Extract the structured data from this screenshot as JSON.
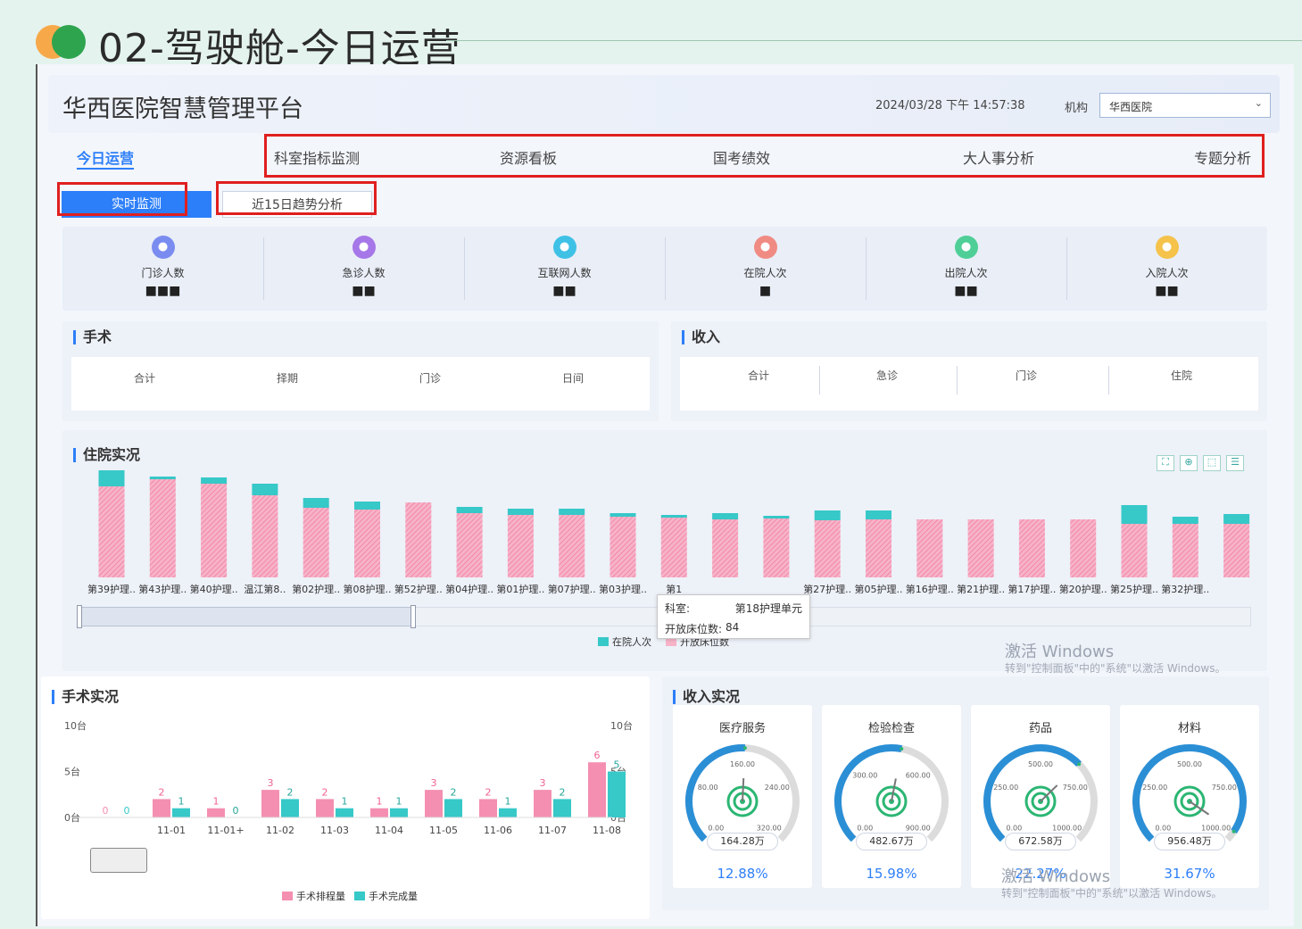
{
  "slide": {
    "title": "02-驾驶舱-今日运营"
  },
  "header": {
    "platform_title": "华西医院智慧管理平台",
    "datetime": "2024/03/28 下午 14:57:38",
    "org_label": "机构",
    "org_value": "华西医院"
  },
  "nav": {
    "tabs": [
      "今日运营",
      "科室指标监测",
      "资源看板",
      "国考绩效",
      "大人事分析",
      "专题分析"
    ]
  },
  "subtabs": [
    "实时监测",
    "近15日趋势分析"
  ],
  "metrics": [
    {
      "label": "门诊人数",
      "value": "■■■",
      "color": "#7b8cf0",
      "icon": "people-icon"
    },
    {
      "label": "急诊人数",
      "value": "■■",
      "color": "#a677e8",
      "icon": "ambulance-icon"
    },
    {
      "label": "互联网人数",
      "value": "■■",
      "color": "#3fc1e6",
      "icon": "globe-icon"
    },
    {
      "label": "在院人次",
      "value": "■",
      "color": "#f08b83",
      "icon": "bed-icon"
    },
    {
      "label": "出院人次",
      "value": "■■",
      "color": "#4fcf97",
      "icon": "bed-out-icon"
    },
    {
      "label": "入院人次",
      "value": "■■",
      "color": "#f5c24a",
      "icon": "crown-icon"
    }
  ],
  "surgery": {
    "title": "手术",
    "items": [
      {
        "label": "合计",
        "value": ""
      },
      {
        "label": "择期",
        "value": ""
      },
      {
        "label": "门诊",
        "value": ""
      },
      {
        "label": "日间",
        "value": ""
      }
    ]
  },
  "income": {
    "title": "收入",
    "items": [
      {
        "label": "合计",
        "value": ""
      },
      {
        "label": "急诊",
        "value": ""
      },
      {
        "label": "门诊",
        "value": ""
      },
      {
        "label": "住院",
        "value": ""
      }
    ]
  },
  "inpatient": {
    "title": "住院实况",
    "legend": [
      "在院人次",
      "开放床位数"
    ],
    "tooltip": {
      "dept_label": "科室:",
      "dept_value": "第18护理单元",
      "beds_label": "开放床位数:",
      "beds_value": "84"
    },
    "toolbar_icons": [
      "fullscreen-icon",
      "zoom-icon",
      "select-icon",
      "list-icon"
    ]
  },
  "chart_data": [
    {
      "type": "bar",
      "title": "住院实况",
      "categories": [
        "第39护理..",
        "第43护理..",
        "第40护理..",
        "温江第8..",
        "第02护理..",
        "第08护理..",
        "第52护理..",
        "第04护理..",
        "第01护理..",
        "第07护理..",
        "第03护理..",
        "第1",
        "",
        "",
        "第27护理..",
        "第05护理..",
        "第16护理..",
        "第21护理..",
        "第17护理..",
        "第20护理..",
        "第25护理..",
        "第32护理..",
        "第18护理单元"
      ],
      "series": [
        {
          "name": "开放床位数",
          "values": [
            102,
            110,
            105,
            92,
            78,
            76,
            84,
            72,
            70,
            70,
            68,
            67,
            65,
            66,
            64,
            65,
            65,
            65,
            65,
            65,
            60,
            60,
            60
          ]
        },
        {
          "name": "在院人次",
          "values": [
            18,
            3,
            7,
            13,
            11,
            9,
            0,
            7,
            7,
            7,
            4,
            3,
            7,
            3,
            11,
            10,
            0,
            0,
            0,
            0,
            21,
            8,
            11
          ]
        }
      ]
    },
    {
      "type": "bar",
      "title": "手术实况",
      "categories": [
        "11-01",
        "11-01+",
        "11-02",
        "11-03",
        "11-04",
        "11-05",
        "11-06",
        "11-07",
        "11-08"
      ],
      "ylim": [
        0,
        10
      ],
      "y_ticks": [
        "0台",
        "5台",
        "10台"
      ],
      "series": [
        {
          "name": "手术排程量",
          "values": [
            2,
            1,
            3,
            2,
            1,
            3,
            2,
            3,
            6
          ],
          "color": "#f48fb1"
        },
        {
          "name": "手术完成量",
          "values": [
            1,
            0,
            2,
            1,
            1,
            2,
            1,
            2,
            5
          ],
          "color": "#37c8c8"
        }
      ],
      "zero_labels": [
        "0",
        "0"
      ]
    }
  ],
  "surgery_live": {
    "title": "手术实况",
    "legend": [
      "手术排程量",
      "手术完成量"
    ]
  },
  "revenue": {
    "title": "收入实况",
    "gauges": [
      {
        "name": "医疗服务",
        "amount": "164.28万",
        "pct": "12.88%",
        "ticks": [
          "0.00",
          "80.00",
          "160.00",
          "240.00",
          "320.00"
        ],
        "fraction": 0.51,
        "color": "#2bb673"
      },
      {
        "name": "检验检查",
        "amount": "482.67万",
        "pct": "15.98%",
        "ticks": [
          "0.00",
          "300.00",
          "600.00",
          "900.00"
        ],
        "fraction": 0.54,
        "color": "#2bb673"
      },
      {
        "name": "药品",
        "amount": "672.58万",
        "pct": "22.27%",
        "ticks": [
          "0.00",
          "250.00",
          "500.00",
          "750.00",
          "1000.00"
        ],
        "fraction": 0.67,
        "color": "#2bb673"
      },
      {
        "name": "材料",
        "amount": "956.48万",
        "pct": "31.67%",
        "ticks": [
          "0.00",
          "250.00",
          "500.00",
          "750.00",
          "1000.00"
        ],
        "fraction": 0.96,
        "color": "#2bb673"
      }
    ]
  },
  "watermark": {
    "title": "激活 Windows",
    "sub": "转到\"控制面板\"中的\"系统\"以激活 Windows。"
  }
}
